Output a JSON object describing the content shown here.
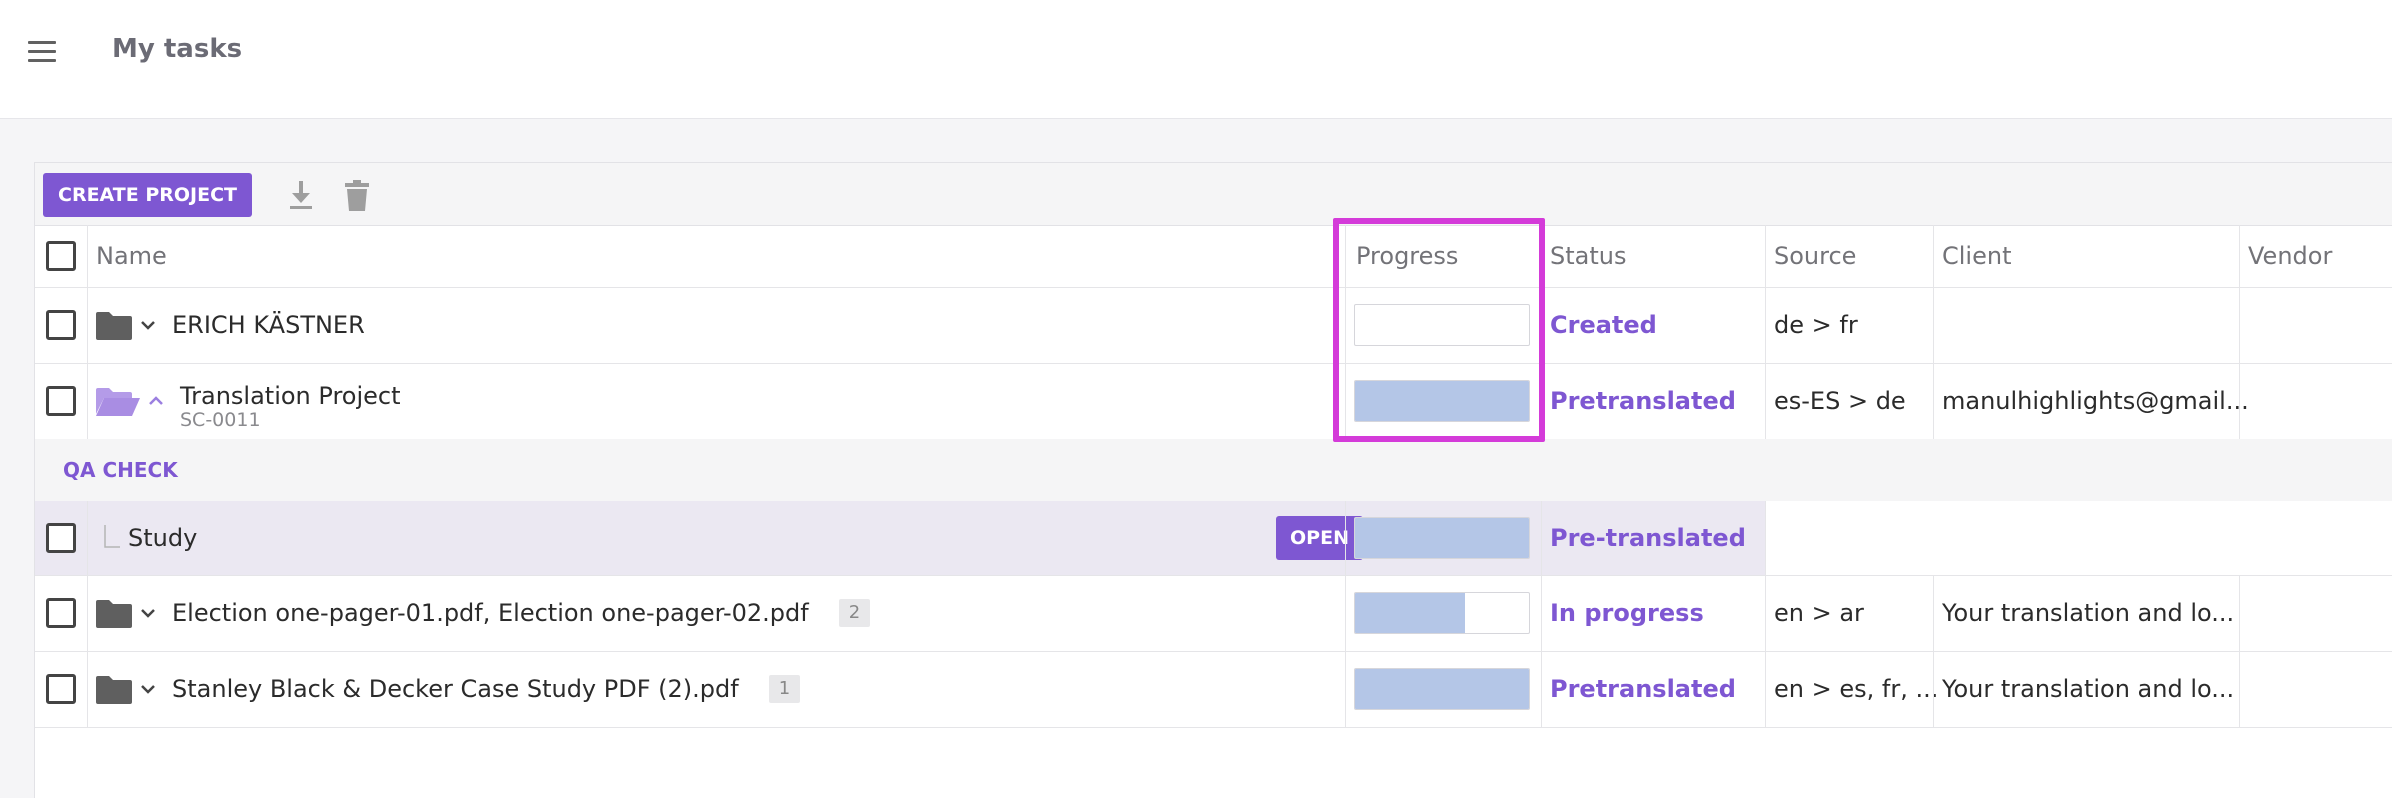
{
  "header": {
    "title": "My tasks"
  },
  "toolbar": {
    "create_label": "CREATE PROJECT"
  },
  "columns": {
    "name": "Name",
    "progress": "Progress",
    "status": "Status",
    "source": "Source",
    "client": "Client",
    "vendor": "Vendor"
  },
  "rows": [
    {
      "name": "ERICH KÄSTNER",
      "progress": 0,
      "status": "Created",
      "source": "de > fr",
      "client": ""
    },
    {
      "name": "Translation Project",
      "code": "SC-0011",
      "progress": 1,
      "status": "Pretranslated",
      "source": "es-ES > de",
      "client": "manulhighlights@gmail..."
    },
    {
      "name": "Election one-pager-01.pdf, Election one-pager-02.pdf",
      "count": "2",
      "progress": 0.63,
      "status": "In progress",
      "source": "en > ar",
      "client": "Your translation and lo..."
    },
    {
      "name": "Stanley Black & Decker Case Study PDF (2).pdf",
      "count": "1",
      "progress": 1,
      "status": "Pretranslated",
      "source": "en > es, fr, ...",
      "client": "Your translation and lo..."
    }
  ],
  "qa": {
    "label": "QA CHECK"
  },
  "subtask": {
    "name": "Study",
    "open_label": "OPEN",
    "progress": 1,
    "status": "Pre-translated"
  },
  "colors": {
    "accent": "#7e57d2",
    "progress_fill": "#b4c6e7",
    "highlight": "#d43bd9"
  }
}
